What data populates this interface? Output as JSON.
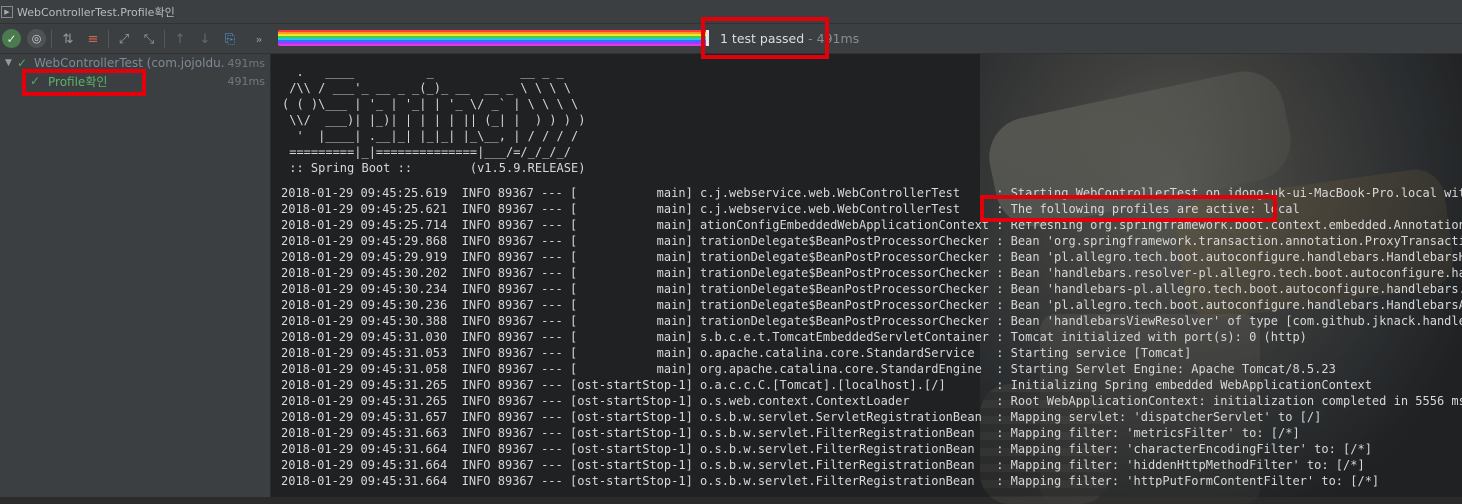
{
  "window": {
    "title": "WebControllerTest.Profile확인"
  },
  "status": {
    "passed": "1 test passed",
    "separator": " - ",
    "time": "491ms"
  },
  "tree": [
    {
      "label": "WebControllerTest (com.jojoldu.",
      "duration": "491ms"
    },
    {
      "label": "Profile확인",
      "duration": "491ms"
    }
  ],
  "banner": [
    "  .   ____          _            __ _ _",
    " /\\\\ / ___'_ __ _ _(_)_ __  __ _ \\ \\ \\ \\",
    "( ( )\\___ | '_ | '_| | '_ \\/ _` | \\ \\ \\ \\",
    " \\\\/  ___)| |_)| | | | | || (_| |  ) ) ) )",
    "  '  |____| .__|_| |_|_| |_\\__, | / / / /",
    " =========|_|==============|___/=/_/_/_/",
    " :: Spring Boot ::        (v1.5.9.RELEASE)"
  ],
  "log": [
    "2018-01-29 09:45:25.619  INFO 89367 --- [           main] c.j.webservice.web.WebControllerTest     : Starting WebControllerTest on idong-uk-ui-MacBook-Pro.local with PID",
    "2018-01-29 09:45:25.621  INFO 89367 --- [           main] c.j.webservice.web.WebControllerTest     : The following profiles are active: local",
    "2018-01-29 09:45:25.714  INFO 89367 --- [           main] ationConfigEmbeddedWebApplicationContext : Refreshing org.springframework.boot.context.embedded.AnnotationConfi",
    "2018-01-29 09:45:29.868  INFO 89367 --- [           main] trationDelegate$BeanPostProcessorChecker : Bean 'org.springframework.transaction.annotation.ProxyTransactionMan",
    "2018-01-29 09:45:29.919  INFO 89367 --- [           main] trationDelegate$BeanPostProcessorChecker : Bean 'pl.allegro.tech.boot.autoconfigure.handlebars.HandlebarsHelper",
    "2018-01-29 09:45:30.202  INFO 89367 --- [           main] trationDelegate$BeanPostProcessorChecker : Bean 'handlebars.resolver-pl.allegro.tech.boot.autoconfigure.handleb",
    "2018-01-29 09:45:30.234  INFO 89367 --- [           main] trationDelegate$BeanPostProcessorChecker : Bean 'handlebars-pl.allegro.tech.boot.autoconfigure.handlebars.Handl",
    "2018-01-29 09:45:30.236  INFO 89367 --- [           main] trationDelegate$BeanPostProcessorChecker : Bean 'pl.allegro.tech.boot.autoconfigure.handlebars.HandlebarsAutoCo",
    "2018-01-29 09:45:30.388  INFO 89367 --- [           main] trationDelegate$BeanPostProcessorChecker : Bean 'handlebarsViewResolver' of type [com.github.jknack.handlebars.",
    "2018-01-29 09:45:31.030  INFO 89367 --- [           main] s.b.c.e.t.TomcatEmbeddedServletContainer : Tomcat initialized with port(s): 0 (http)",
    "2018-01-29 09:45:31.053  INFO 89367 --- [           main] o.apache.catalina.core.StandardService   : Starting service [Tomcat]",
    "2018-01-29 09:45:31.058  INFO 89367 --- [           main] org.apache.catalina.core.StandardEngine  : Starting Servlet Engine: Apache Tomcat/8.5.23",
    "2018-01-29 09:45:31.265  INFO 89367 --- [ost-startStop-1] o.a.c.c.C.[Tomcat].[localhost].[/]       : Initializing Spring embedded WebApplicationContext",
    "2018-01-29 09:45:31.265  INFO 89367 --- [ost-startStop-1] o.s.web.context.ContextLoader            : Root WebApplicationContext: initialization completed in 5556 ms",
    "2018-01-29 09:45:31.657  INFO 89367 --- [ost-startStop-1] o.s.b.w.servlet.ServletRegistrationBean  : Mapping servlet: 'dispatcherServlet' to [/]",
    "2018-01-29 09:45:31.663  INFO 89367 --- [ost-startStop-1] o.s.b.w.servlet.FilterRegistrationBean   : Mapping filter: 'metricsFilter' to: [/*]",
    "2018-01-29 09:45:31.664  INFO 89367 --- [ost-startStop-1] o.s.b.w.servlet.FilterRegistrationBean   : Mapping filter: 'characterEncodingFilter' to: [/*]",
    "2018-01-29 09:45:31.664  INFO 89367 --- [ost-startStop-1] o.s.b.w.servlet.FilterRegistrationBean   : Mapping filter: 'hiddenHttpMethodFilter' to: [/*]",
    "2018-01-29 09:45:31.664  INFO 89367 --- [ost-startStop-1] o.s.b.w.servlet.FilterRegistrationBean   : Mapping filter: 'httpPutFormContentFilter' to: [/*]"
  ]
}
